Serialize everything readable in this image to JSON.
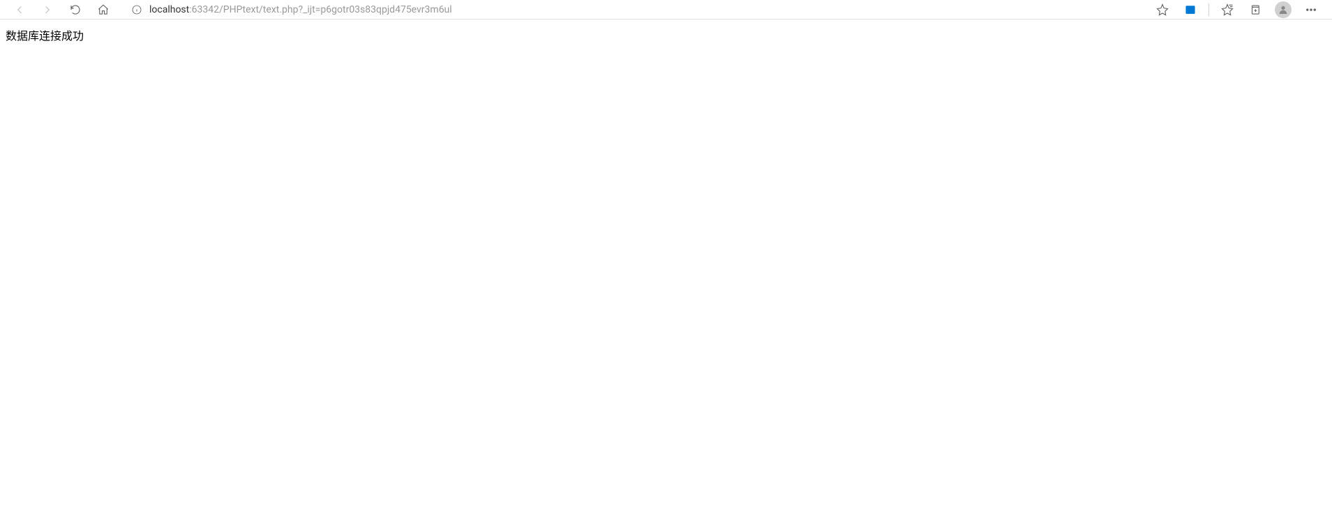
{
  "address": {
    "host": "localhost",
    "rest": ":63342/PHPtext/text.php?_ijt=p6gotr03s83qpjd475evr3m6ul"
  },
  "page": {
    "message": "数据库连接成功"
  }
}
